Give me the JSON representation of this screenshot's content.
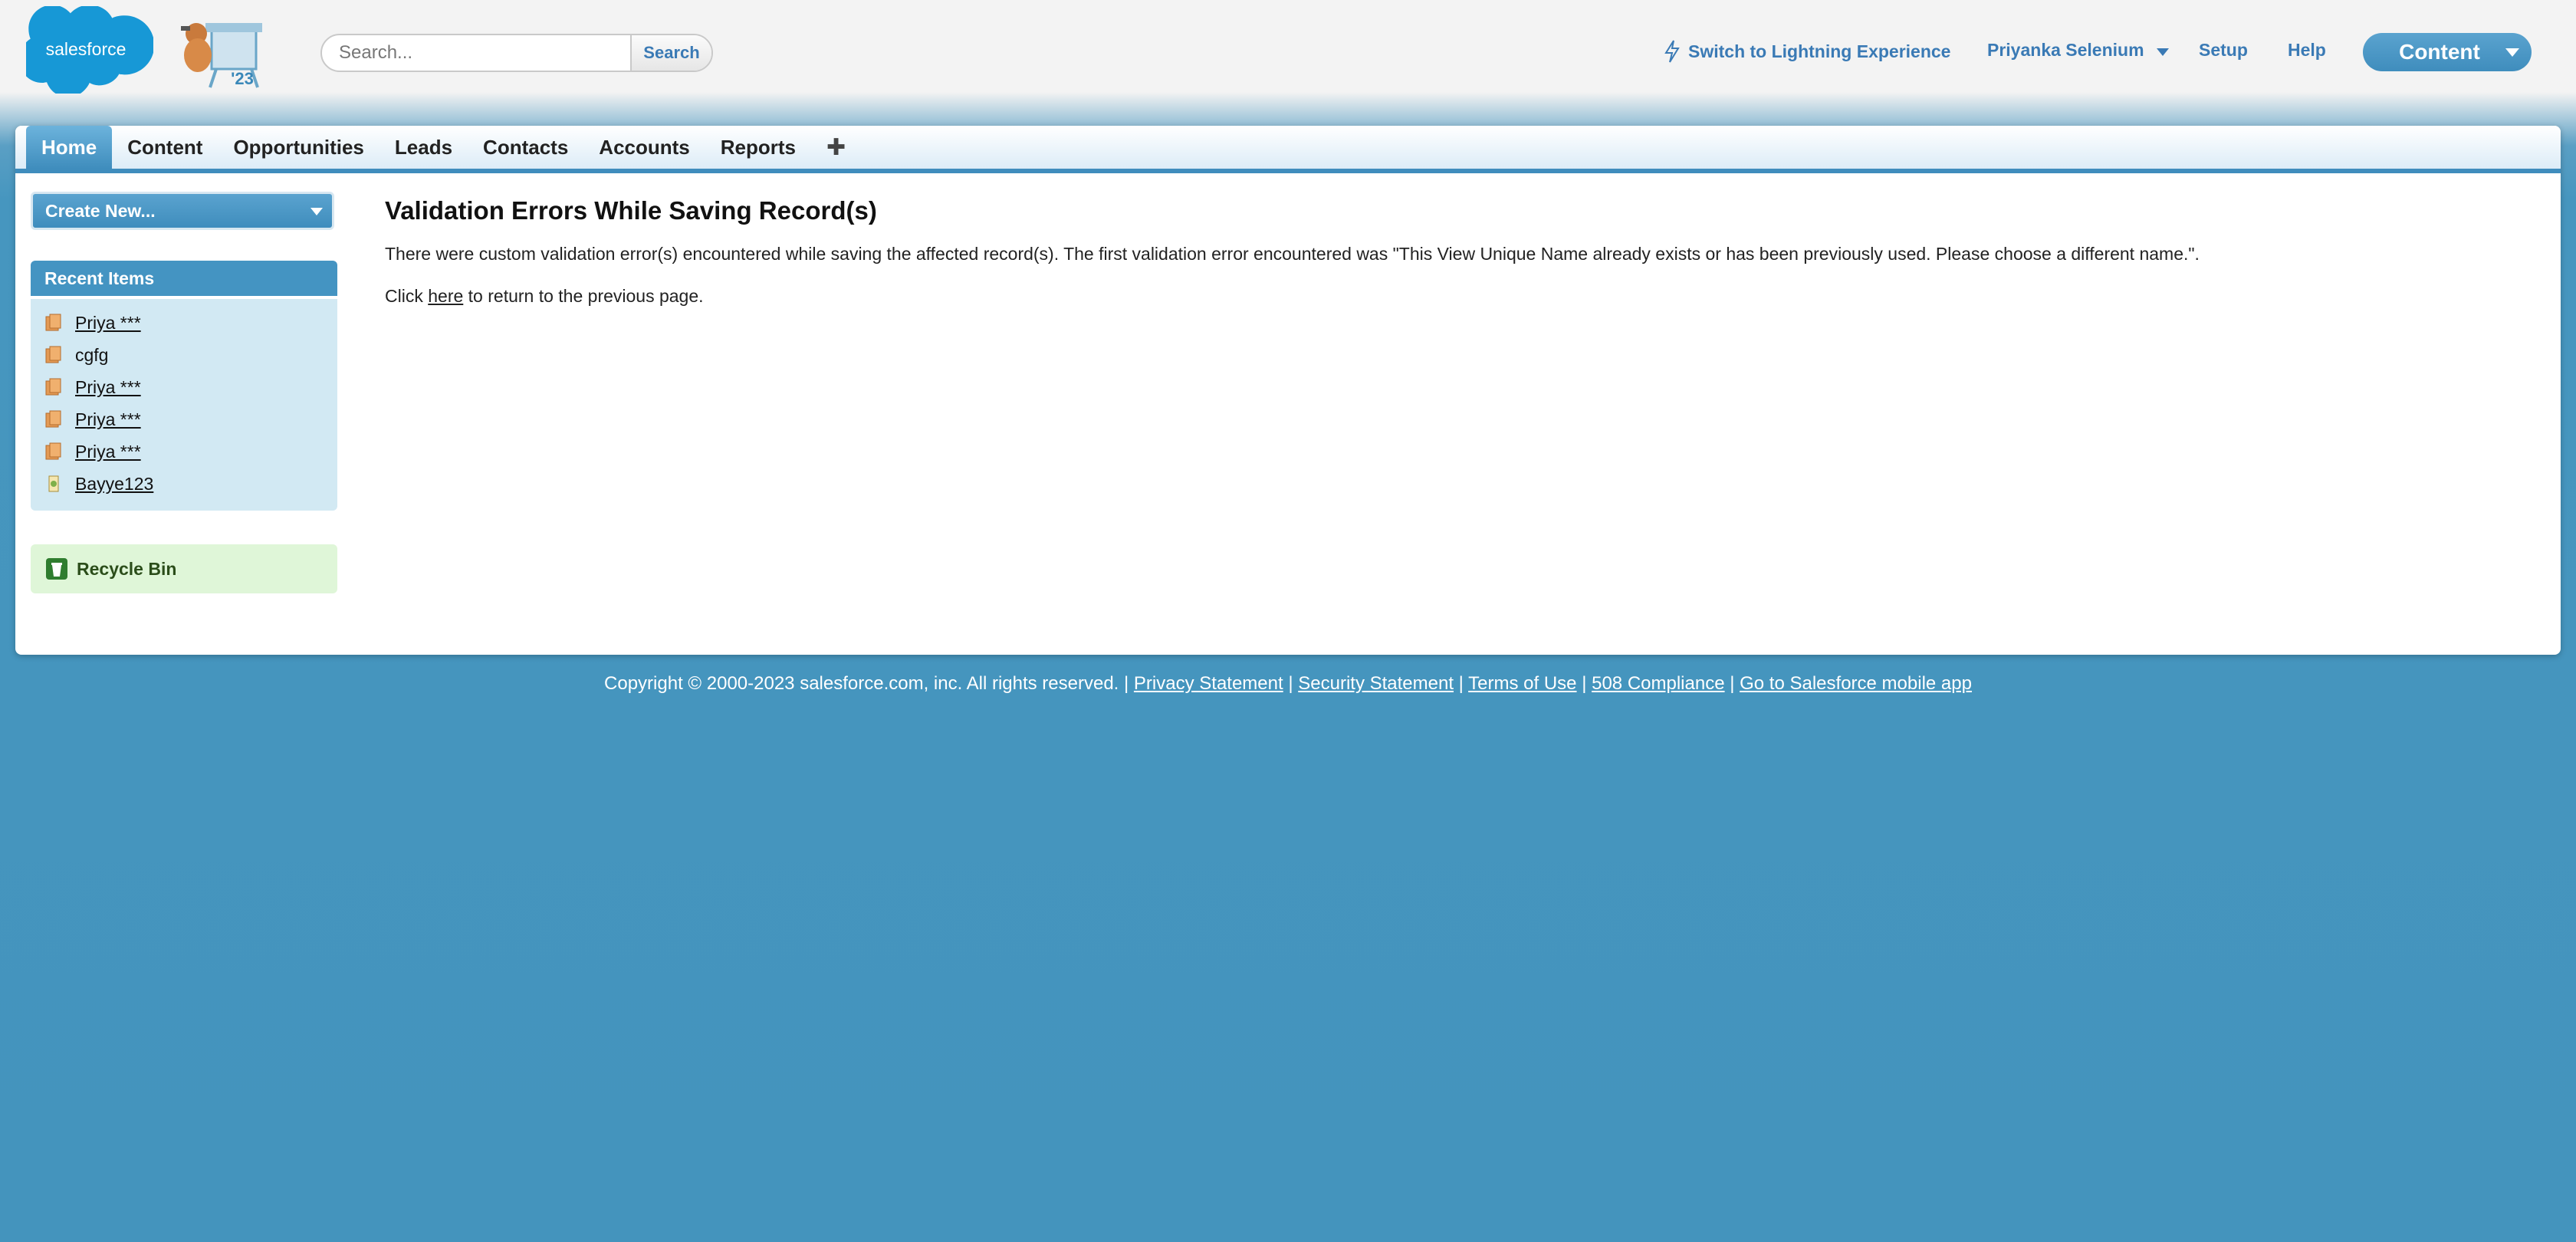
{
  "header": {
    "logo_text": "salesforce",
    "mascot_year": "'23",
    "search_placeholder": "Search...",
    "search_button": "Search",
    "lightning_link": "Switch to Lightning Experience",
    "user_name": "Priyanka Selenium",
    "setup_link": "Setup",
    "help_link": "Help",
    "app_menu_label": "Content"
  },
  "tabs": [
    {
      "label": "Home",
      "active": true
    },
    {
      "label": "Content"
    },
    {
      "label": "Opportunities"
    },
    {
      "label": "Leads"
    },
    {
      "label": "Contacts"
    },
    {
      "label": "Accounts"
    },
    {
      "label": "Reports"
    }
  ],
  "tab_plus": "✚",
  "sidebar": {
    "create_new": "Create New...",
    "recent_items_title": "Recent Items",
    "recent_items": [
      {
        "label": "Priya ***",
        "icon": "content-icon"
      },
      {
        "label": "cgfg",
        "icon": "content-icon"
      },
      {
        "label": "Priya ***",
        "icon": "content-icon"
      },
      {
        "label": "Priya ***",
        "icon": "content-icon"
      },
      {
        "label": "Priya ***",
        "icon": "content-icon"
      },
      {
        "label": "Bayye123",
        "icon": "library-icon"
      }
    ],
    "recycle_bin": "Recycle Bin"
  },
  "main": {
    "title": "Validation Errors While Saving Record(s)",
    "error_message": "There were custom validation error(s) encountered while saving the affected record(s). The first validation error encountered was \"This View Unique Name already exists or has been previously used. Please choose a different name.\".",
    "return_prefix": "Click ",
    "return_link": "here",
    "return_suffix": " to return to the previous page."
  },
  "footer": {
    "copyright": "Copyright © 2000-2023 salesforce.com, inc. All rights reserved. | ",
    "links": [
      "Privacy Statement",
      "Security Statement",
      "Terms of Use",
      "508 Compliance",
      "Go to Salesforce mobile app"
    ],
    "separator": " | "
  },
  "colors": {
    "brand": "#00a1e0",
    "tab_active": "#3f8dbd",
    "link": "#3a7ab5",
    "background": "#4494bd"
  }
}
